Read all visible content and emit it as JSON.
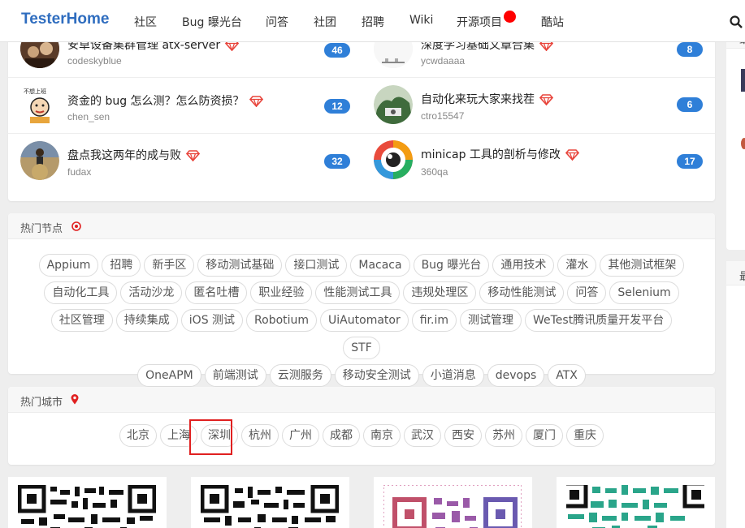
{
  "nav": {
    "brand": "TesterHome",
    "items": [
      "社区",
      "Bug 曝光台",
      "问答",
      "社团",
      "招聘",
      "Wiki",
      "开源项目",
      "酷站"
    ]
  },
  "topics": [
    {
      "title": "安卓设备集群管理 atx-server",
      "user": "codeskyblue",
      "count": "46"
    },
    {
      "title": "深度学习基础文章合集",
      "user": "ycwdaaaa",
      "count": "8"
    },
    {
      "title": "资金的 bug 怎么测？怎么防资损？",
      "user": "chen_sen",
      "count": "12"
    },
    {
      "title": "自动化来玩大家来找茬",
      "user": "ctro15547",
      "count": "6"
    },
    {
      "title": "盘点我这两年的成与败",
      "user": "fudax",
      "count": "32"
    },
    {
      "title": "minicap 工具的剖析与修改",
      "user": "360qa",
      "count": "17"
    }
  ],
  "hot_nodes": {
    "title": "热门节点",
    "rows": [
      [
        "Appium",
        "招聘",
        "新手区",
        "移动测试基础",
        "接口测试",
        "Macaca",
        "Bug 曝光台",
        "通用技术",
        "灌水",
        "其他测试框架"
      ],
      [
        "自动化工具",
        "活动沙龙",
        "匿名吐槽",
        "职业经验",
        "性能测试工具",
        "违规处理区",
        "移动性能测试",
        "问答",
        "Selenium"
      ],
      [
        "社区管理",
        "持续集成",
        "iOS 测试",
        "Robotium",
        "UiAutomator",
        "fir.im",
        "测试管理",
        "WeTest腾讯质量开发平台",
        "STF"
      ],
      [
        "OneAPM",
        "前端测试",
        "云测服务",
        "移动安全测试",
        "小道消息",
        "devops",
        "ATX"
      ]
    ]
  },
  "hot_cities": {
    "title": "热门城市",
    "items": [
      "北京",
      "上海",
      "深圳",
      "杭州",
      "广州",
      "成都",
      "南京",
      "武汉",
      "西安",
      "苏州",
      "厦门",
      "重庆"
    ]
  },
  "side": {
    "head1": "最",
    "head2": "最"
  },
  "colors": {
    "brand": "#2f6dbf",
    "badge": "#2f7fd8",
    "diamond": "#e8453c",
    "highlight": "#e02020",
    "notify": "#ff0000"
  }
}
